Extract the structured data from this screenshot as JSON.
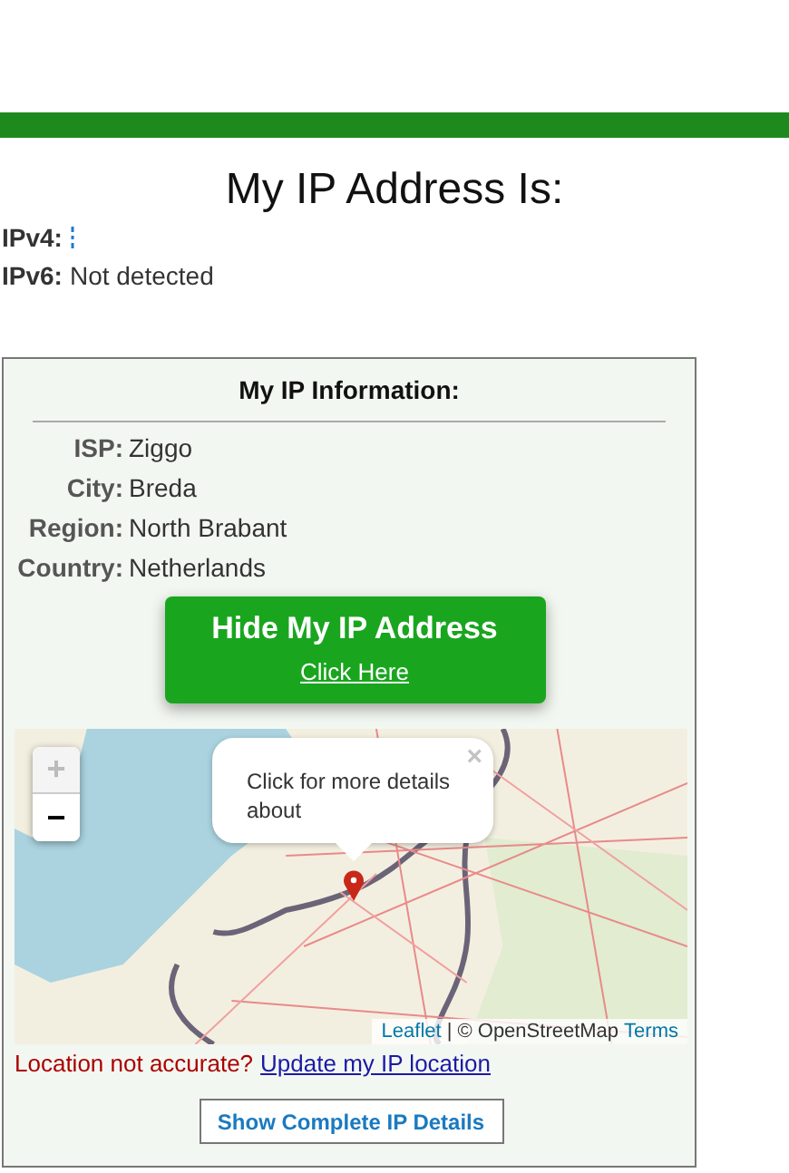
{
  "title": "My IP Address Is:",
  "addresses": [
    {
      "label": "IPv4:",
      "value_hidden": true
    },
    {
      "label": "IPv6:",
      "value": "Not detected",
      "value_hidden": false
    }
  ],
  "info_panel": {
    "heading": "My IP Information:",
    "rows": [
      {
        "label": "ISP:",
        "value": "Ziggo"
      },
      {
        "label": "City:",
        "value": "Breda"
      },
      {
        "label": "Region:",
        "value": "North Brabant"
      },
      {
        "label": "Country:",
        "value": "Netherlands"
      }
    ],
    "hide_button": {
      "title": "Hide My IP Address",
      "link": "Click Here"
    },
    "map": {
      "kind": "picture",
      "zoom_in": {
        "label": "+",
        "disabled": true
      },
      "zoom_out": {
        "label": "−",
        "disabled": false
      },
      "popup": {
        "text": "Click for more details about",
        "close": "×"
      },
      "attribution": {
        "leaflet": "Leaflet",
        "separator": "| © OpenStreetMap",
        "terms": "Terms"
      }
    },
    "accuracy": {
      "question": "Location not accurate?",
      "link": "Update my IP location"
    },
    "details_button": "Show Complete IP Details"
  }
}
